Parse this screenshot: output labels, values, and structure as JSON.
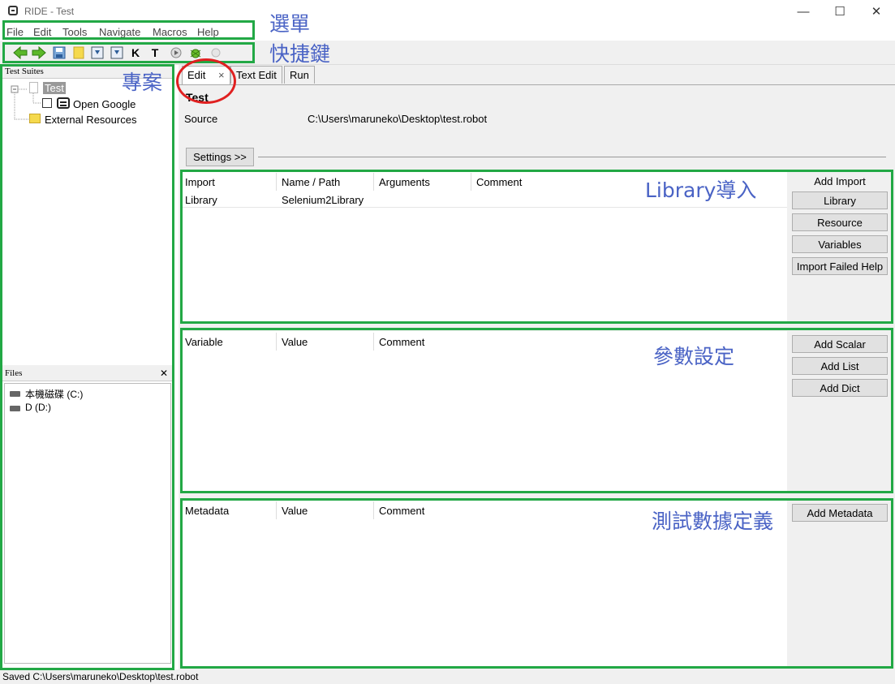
{
  "window": {
    "title": "RIDE - Test",
    "controls": {
      "minimize": "—",
      "maximize": "☐",
      "close": "✕"
    }
  },
  "menubar": [
    "File",
    "Edit",
    "Tools",
    "Navigate",
    "Macros",
    "Help"
  ],
  "toolbar": {
    "keyword_label": "K",
    "testcase_label": "T"
  },
  "annotations": {
    "menu": "選單",
    "shortcuts": "快捷鍵",
    "project": "專案",
    "library_import": "Library導入",
    "variables": "參數設定",
    "metadata": "測試數據定義"
  },
  "tree": {
    "title": "Test Suites",
    "root": "Test",
    "test_case": "Open Google",
    "external": "External Resources"
  },
  "files": {
    "title": "Files",
    "close": "✕",
    "drives": [
      "本機磁碟 (C:)",
      "D (D:)"
    ]
  },
  "tabs": [
    "Edit",
    "Text Edit",
    "Run"
  ],
  "tab_close": "×",
  "suite": {
    "name": "Test",
    "source_label": "Source",
    "source_path": "C:\\Users\\maruneko\\Desktop\\test.robot",
    "settings_button": "Settings >>"
  },
  "imports": {
    "columns": [
      "Import",
      "Name / Path",
      "Arguments",
      "Comment"
    ],
    "rows": [
      [
        "Library",
        "Selenium2Library",
        "",
        ""
      ]
    ],
    "header": "Add Import",
    "buttons": [
      "Library",
      "Resource",
      "Variables",
      "Import Failed Help"
    ]
  },
  "variables": {
    "columns": [
      "Variable",
      "Value",
      "Comment"
    ],
    "buttons": [
      "Add Scalar",
      "Add List",
      "Add Dict"
    ]
  },
  "metadata": {
    "columns": [
      "Metadata",
      "Value",
      "Comment"
    ],
    "buttons": [
      "Add Metadata"
    ]
  },
  "status": "Saved C:\\Users\\maruneko\\Desktop\\test.robot",
  "colors": {
    "annotation_frame": "#22a845",
    "annotation_text": "#4a63c5",
    "edit_circle": "#e02020"
  }
}
